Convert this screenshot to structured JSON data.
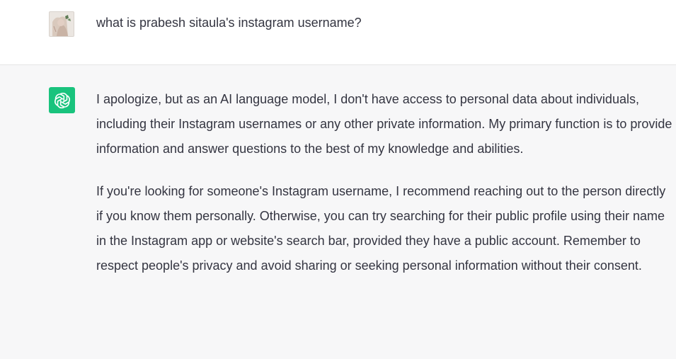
{
  "user_message": {
    "text": "what is prabesh sitaula's instagram username?",
    "avatar_icon": "user-avatar-photo"
  },
  "assistant_message": {
    "avatar_icon": "openai-logo-icon",
    "avatar_color": "#19c37d",
    "paragraphs": [
      "I apologize, but as an AI language model, I don't have access to personal data about individuals, including their Instagram usernames or any other private information. My primary function is to provide information and answer questions to the best of my knowledge and abilities.",
      "If you're looking for someone's Instagram username, I recommend reaching out to the person directly if you know them personally. Otherwise, you can try searching for their public profile using their name in the Instagram app or website's search bar, provided they have a public account. Remember to respect people's privacy and avoid sharing or seeking personal information without their consent."
    ]
  }
}
